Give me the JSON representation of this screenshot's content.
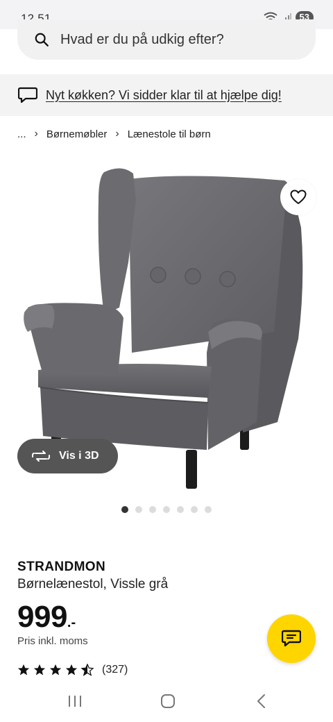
{
  "status_bar": {
    "time": "12.51",
    "battery": "53",
    "icons": [
      "wifi-icon",
      "signal-icon",
      "battery-icon"
    ]
  },
  "search": {
    "placeholder": "Hvad er du på udkig efter?",
    "icon": "search-icon"
  },
  "promo": {
    "icon": "chat-bubble-icon",
    "text": "Nyt køkken? Vi sidder klar til at hjælpe dig!"
  },
  "breadcrumb": {
    "items": [
      "...",
      "Børnemøbler",
      "Lænestole til børn"
    ]
  },
  "gallery": {
    "view3d_label": "Vis i 3D",
    "view3d_icon": "rotate-3d-icon",
    "favorite_icon": "heart-icon",
    "total_images": 7,
    "active_index": 0
  },
  "product": {
    "name": "STRANDMON",
    "description": "Børnelænestol, Vissle grå",
    "price_integer": "999",
    "price_suffix": ".-",
    "vat_note": "Pris inkl. moms",
    "rating": 4.5,
    "rating_max": 5,
    "review_count": "(327)"
  },
  "chat_fab": {
    "icon": "chat-icon"
  },
  "colors": {
    "brand_yellow": "#ffd500",
    "chair_gray": "#6e6e72",
    "pill_dark": "#555555"
  },
  "nav_bar": {
    "buttons": [
      "recent-apps-icon",
      "home-icon",
      "back-icon"
    ]
  }
}
